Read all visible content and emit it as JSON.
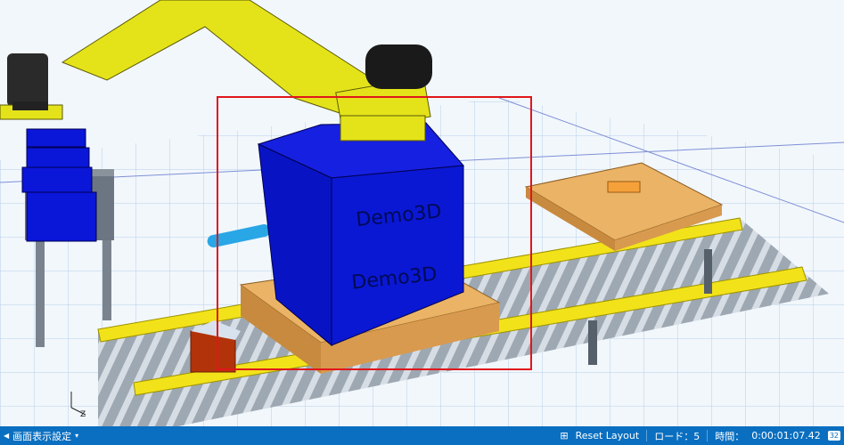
{
  "viewport": {
    "cube_label": "Demo3D",
    "selection_color": "#e0161b",
    "colors": {
      "cube": "#0a16d8",
      "robot": "#e3e31a",
      "pallet": "#eab365",
      "conveyor_frame": "#f2e21a",
      "roller": "#9aa3ac",
      "grid": "#b8cde4"
    }
  },
  "statusbar": {
    "display_settings_label": "画面表示設定",
    "layout_icon": "grid-layout-icon",
    "reset_layout_label": "Reset Layout",
    "load_label": "ロード：5",
    "time_label": "時間：",
    "time_value": "0:00:01:07.42",
    "corner_badge": "32"
  }
}
